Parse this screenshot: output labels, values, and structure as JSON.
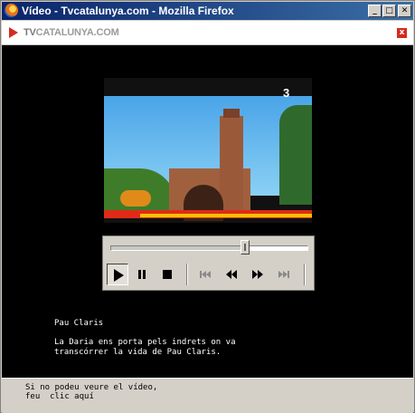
{
  "window": {
    "title": "Vídeo - Tvcatalunya.com - Mozilla Firefox",
    "min_label": "_",
    "max_label": "□",
    "close_label": "✕"
  },
  "brand": {
    "prefix": "TV",
    "name": "CATALUNYA.COM",
    "close_label": "x",
    "accent": "#d62b1e"
  },
  "video": {
    "channel_logo": "3",
    "progress": 0.68
  },
  "controls": {
    "icons": [
      "play-icon",
      "pause-icon",
      "stop-icon",
      "skip-back-icon",
      "rewind-icon",
      "fast-forward-icon",
      "skip-forward-icon"
    ]
  },
  "caption": {
    "title": "Pau Claris",
    "line1": "La Daria ens porta pels indrets on va",
    "line2": "transcórrer la vida de Pau Claris."
  },
  "footer": {
    "line1": "Si no podeu veure el vídeo,",
    "line2": "feu  clic aquí"
  }
}
